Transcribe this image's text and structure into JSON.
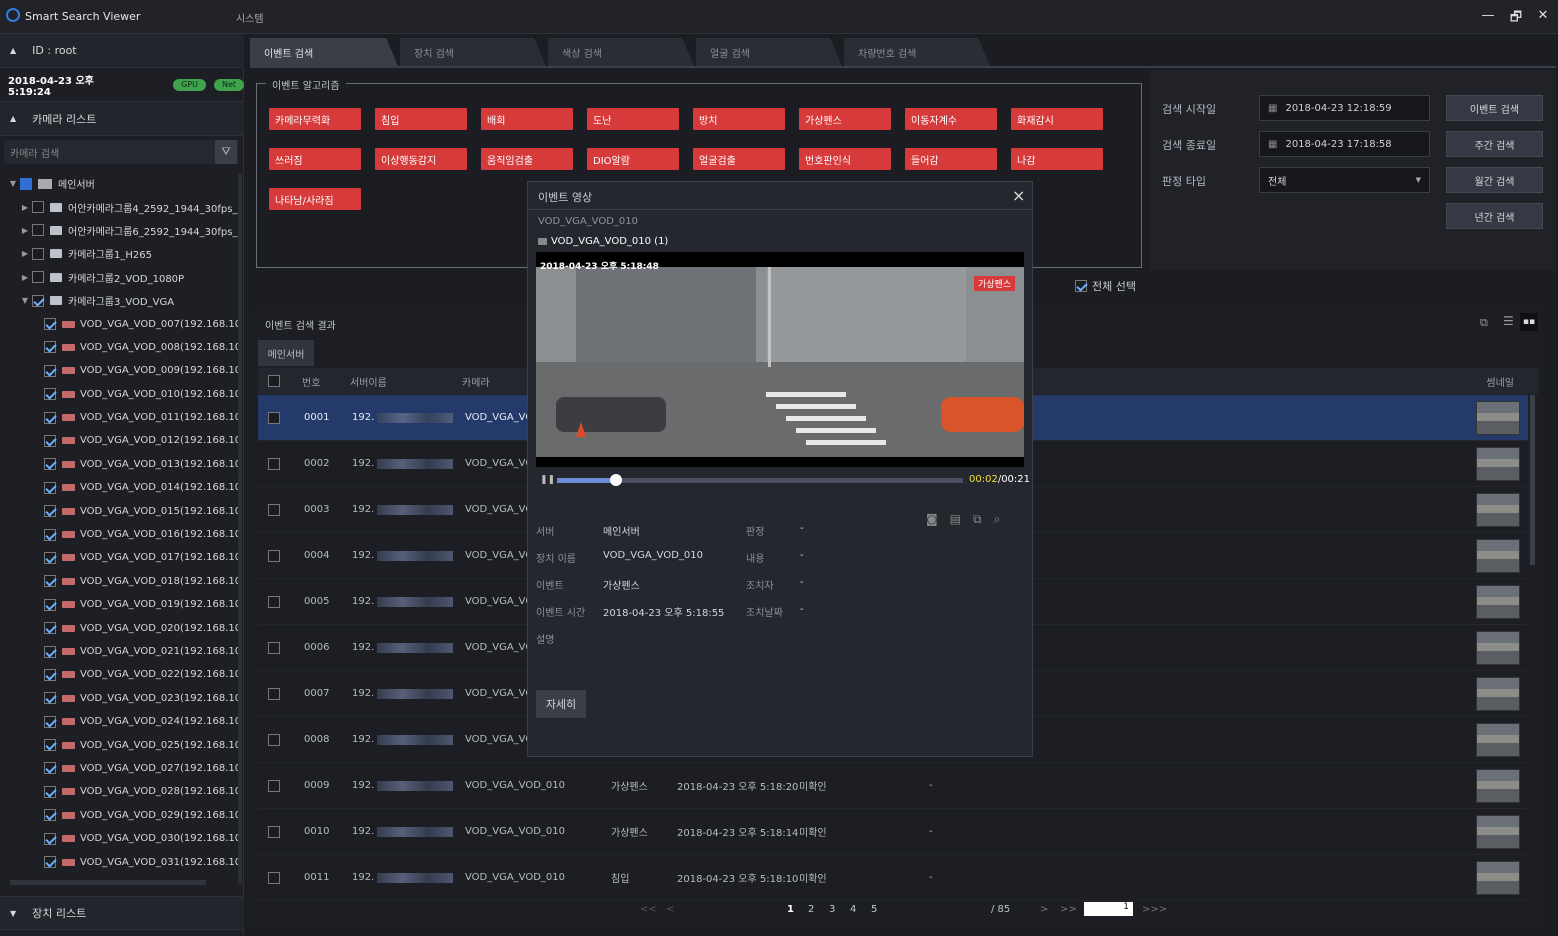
{
  "app": {
    "title": "Smart Search Viewer",
    "menu": "시스템",
    "minimize": "—",
    "restore": "🗗",
    "close": "✕"
  },
  "sidebar": {
    "user": "ID : root",
    "datetime": "2018-04-23 오후 5:19:24",
    "badges": [
      "GPU",
      "Net"
    ],
    "camera_list_label": "카메라 리스트",
    "camera_search_placeholder": "카메라 검색",
    "device_list_label": "장치 리스트",
    "tree": {
      "root": "메인서버",
      "groups": [
        "어안카메라그룹4_2592_1944_30fps_5",
        "어안카메라그룹6_2592_1944_30fps_5",
        "카메라그룹1_H265",
        "카메라그룹2_VOD_1080P",
        "카메라그룹3_VOD_VGA"
      ],
      "cameras": [
        "VOD_VGA_VOD_007(192.168.108.",
        "VOD_VGA_VOD_008(192.168.108.",
        "VOD_VGA_VOD_009(192.168.108.",
        "VOD_VGA_VOD_010(192.168.108.",
        "VOD_VGA_VOD_011(192.168.108.",
        "VOD_VGA_VOD_012(192.168.108.",
        "VOD_VGA_VOD_013(192.168.108.",
        "VOD_VGA_VOD_014(192.168.108.",
        "VOD_VGA_VOD_015(192.168.108.",
        "VOD_VGA_VOD_016(192.168.108.",
        "VOD_VGA_VOD_017(192.168.108.",
        "VOD_VGA_VOD_018(192.168.108.",
        "VOD_VGA_VOD_019(192.168.108.",
        "VOD_VGA_VOD_020(192.168.108.",
        "VOD_VGA_VOD_021(192.168.108.",
        "VOD_VGA_VOD_022(192.168.108.",
        "VOD_VGA_VOD_023(192.168.108.",
        "VOD_VGA_VOD_024(192.168.108.",
        "VOD_VGA_VOD_025(192.168.108.",
        "VOD_VGA_VOD_027(192.168.108.",
        "VOD_VGA_VOD_028(192.168.108.",
        "VOD_VGA_VOD_029(192.168.108.",
        "VOD_VGA_VOD_030(192.168.108.",
        "VOD_VGA_VOD_031(192.168.108."
      ]
    }
  },
  "tabs": [
    "이벤트 검색",
    "장치 검색",
    "색상 검색",
    "얼굴 검색",
    "차량번호 검색"
  ],
  "algorithms": {
    "label": "이벤트 알고리즘",
    "items": [
      "카메라무력화",
      "침입",
      "배회",
      "도난",
      "방치",
      "가상펜스",
      "이동자계수",
      "화재감시",
      "쓰러짐",
      "이상행동감지",
      "움직임검출",
      "DIO알람",
      "얼굴검출",
      "번호판인식",
      "들어감",
      "나감",
      "나타남/사라짐"
    ],
    "select_all": "전체 선택"
  },
  "search": {
    "start_label": "검색 시작일",
    "start_value": "2018-04-23 12:18:59",
    "end_label": "검색 종료일",
    "end_value": "2018-04-23 17:18:58",
    "type_label": "판정 타입",
    "type_value": "전체",
    "buttons": [
      "이벤트 검색",
      "주간 검색",
      "월간 검색",
      "년간 검색"
    ]
  },
  "results": {
    "label": "이벤트 검색 결과",
    "server_tab": "메인서버",
    "columns": {
      "no": "번호",
      "server": "서버이름",
      "camera": "카메라",
      "thumb": "썸네일"
    },
    "rows": [
      {
        "no": "0001",
        "server": "192.",
        "camera": "VOD_VGA_VO",
        "event": "",
        "time": "",
        "status": "",
        "dash": ""
      },
      {
        "no": "0002",
        "server": "192.",
        "camera": "VOD_VGA_VO",
        "event": "",
        "time": "",
        "status": "",
        "dash": ""
      },
      {
        "no": "0003",
        "server": "192.",
        "camera": "VOD_VGA_VO",
        "event": "",
        "time": "",
        "status": "",
        "dash": ""
      },
      {
        "no": "0004",
        "server": "192.",
        "camera": "VOD_VGA_VO",
        "event": "",
        "time": "",
        "status": "",
        "dash": ""
      },
      {
        "no": "0005",
        "server": "192.",
        "camera": "VOD_VGA_VO",
        "event": "",
        "time": "",
        "status": "",
        "dash": ""
      },
      {
        "no": "0006",
        "server": "192.",
        "camera": "VOD_VGA_VO",
        "event": "",
        "time": "",
        "status": "",
        "dash": ""
      },
      {
        "no": "0007",
        "server": "192.",
        "camera": "VOD_VGA_VO",
        "event": "",
        "time": "",
        "status": "",
        "dash": ""
      },
      {
        "no": "0008",
        "server": "192.",
        "camera": "VOD_VGA_VO",
        "event": "",
        "time": "",
        "status": "",
        "dash": ""
      },
      {
        "no": "0009",
        "server": "192.",
        "camera": "VOD_VGA_VOD_010",
        "event": "가상펜스",
        "time": "2018-04-23 오후 5:18:20",
        "status": "미확인",
        "dash": "-"
      },
      {
        "no": "0010",
        "server": "192.",
        "camera": "VOD_VGA_VOD_010",
        "event": "가상펜스",
        "time": "2018-04-23 오후 5:18:14",
        "status": "미확인",
        "dash": "-"
      },
      {
        "no": "0011",
        "server": "192.",
        "camera": "VOD_VGA_VOD_010",
        "event": "침입",
        "time": "2018-04-23 오후 5:18:10",
        "status": "미확인",
        "dash": "-"
      }
    ],
    "pagination": {
      "first": "<<",
      "prev": "<",
      "pages": [
        "1",
        "2",
        "3",
        "4",
        "5"
      ],
      "total": "/ 85",
      "next": ">",
      "next_block": ">>",
      "page_input": "1",
      "last": ">>>"
    }
  },
  "popup": {
    "title": "이벤트 영상",
    "camera": "VOD_VGA_VOD_010",
    "stream": "VOD_VGA_VOD_010 (1)",
    "timestamp": "2018-04-23 오후 5:18:48",
    "overlay_tag": "가상펜스",
    "time_current": "00:02",
    "time_total": "/00:21",
    "progress": 0.1,
    "info": {
      "server_label": "서버",
      "server": "메인서버",
      "device_label": "장치 이름",
      "device": "VOD_VGA_VOD_010",
      "event_label": "이벤트",
      "event": "가상펜스",
      "time_label": "이벤트 시간",
      "time": "2018-04-23 오후 5:18:55",
      "desc_label": "설명",
      "judge_label": "판정",
      "judge": "-",
      "content_label": "내용",
      "content": "-",
      "actor_label": "조치자",
      "actor": "-",
      "date_label": "조치날짜",
      "date": "-"
    },
    "detail_button": "자세히",
    "close": "×"
  }
}
